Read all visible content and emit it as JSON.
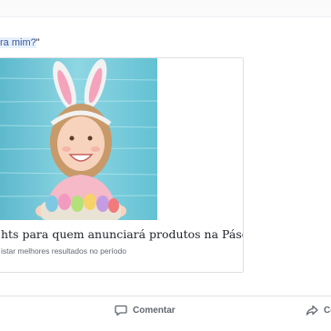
{
  "post": {
    "text_highlight": "ra mim?",
    "text_tail": "\""
  },
  "link_card": {
    "title": "hts para quem anunciará produtos na Páscoa",
    "description": "istar melhores resultados no período",
    "image_icon": "easter-girl-photo"
  },
  "actions": {
    "comment_label": "Comentar",
    "comment_icon": "comment-icon",
    "share_label": "Co",
    "share_icon": "share-icon"
  },
  "colors": {
    "link_blue": "#385898",
    "highlight_bg": "#e7f0fd",
    "secondary_text": "#606770",
    "action_text": "#616770",
    "card_border": "#dddfe2"
  }
}
